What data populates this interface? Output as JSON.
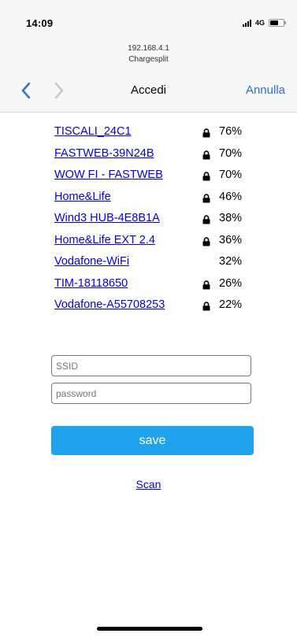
{
  "status_bar": {
    "time": "14:09",
    "network": "4G",
    "battery_level": 0.65
  },
  "address": {
    "url": "192.168.4.1",
    "site_title": "Chargesplit"
  },
  "nav": {
    "title": "Accedi",
    "cancel_label": "Annulla"
  },
  "networks": [
    {
      "ssid": "TISCALI_24C1",
      "locked": true,
      "signal": "76%"
    },
    {
      "ssid": "FASTWEB-39N24B",
      "locked": true,
      "signal": "70%"
    },
    {
      "ssid": "WOW FI - FASTWEB",
      "locked": true,
      "signal": "70%"
    },
    {
      "ssid": "Home&Life",
      "locked": true,
      "signal": "46%"
    },
    {
      "ssid": "Wind3 HUB-4E8B1A",
      "locked": true,
      "signal": "38%"
    },
    {
      "ssid": "Home&Life EXT 2.4",
      "locked": true,
      "signal": "36%"
    },
    {
      "ssid": "Vodafone-WiFi",
      "locked": false,
      "signal": "32%"
    },
    {
      "ssid": "TIM-18118650",
      "locked": true,
      "signal": "26%"
    },
    {
      "ssid": "Vodafone-A55708253",
      "locked": true,
      "signal": "22%"
    }
  ],
  "form": {
    "ssid_placeholder": "SSID",
    "password_placeholder": "password",
    "save_label": "save",
    "scan_label": "Scan"
  },
  "colors": {
    "link": "#0000ee",
    "save_button": "#1fa3ec",
    "nav_accent": "#2b73d6"
  }
}
